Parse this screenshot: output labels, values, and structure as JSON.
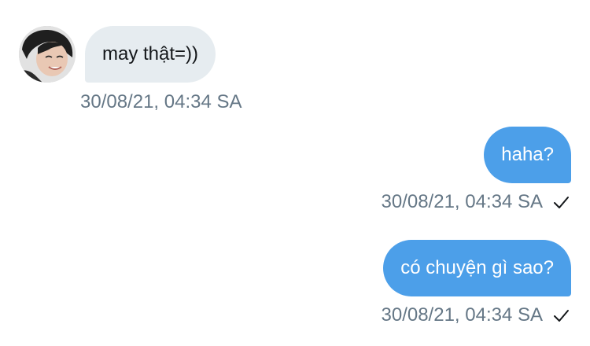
{
  "conversation": {
    "messages": [
      {
        "direction": "incoming",
        "text": "may thật=))",
        "timestamp": "30/08/21, 04:34 SA",
        "avatar_icon": "user-avatar-photo"
      },
      {
        "direction": "outgoing",
        "text": "haha?",
        "timestamp": "30/08/21, 04:34 SA",
        "status_icon": "check-icon"
      },
      {
        "direction": "outgoing",
        "text": "có chuyện gì sao?",
        "timestamp": "30/08/21, 04:34 SA",
        "status_icon": "check-icon"
      }
    ]
  },
  "colors": {
    "incoming_bubble": "#e6ecf0",
    "outgoing_bubble": "#4c9fe9",
    "timestamp_text": "#657786",
    "incoming_text": "#14171a",
    "outgoing_text": "#ffffff"
  }
}
